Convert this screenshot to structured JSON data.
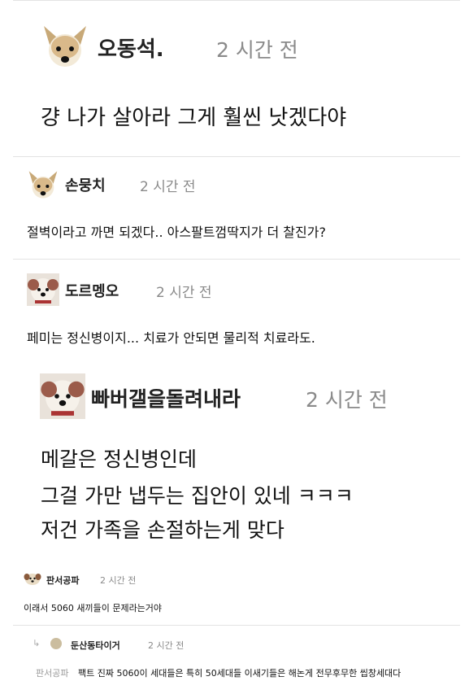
{
  "comments": [
    {
      "author": "오동석.",
      "time": "2 시간 전",
      "text": "걍 나가 살아라 그게 훨씬 낫겠다야",
      "avatar_icon": "dog-face-icon"
    },
    {
      "author": "손뭉치",
      "time": "2 시간 전",
      "text": "절벽이라고 까면 되겠다.. 아스팔트껌딱지가 더 찰진가?",
      "avatar_icon": "dog-face-icon"
    },
    {
      "author": "도르멩오",
      "time": "2 시간 전",
      "text": "페미는 정신병이지... 치료가 안되면 물리적 치료라도.",
      "avatar_icon": "fluffy-dog-icon"
    },
    {
      "author": "빠버갤을돌려내라",
      "time": "2 시간 전",
      "lines": [
        "메갈은 정신병인데",
        "그걸 가만 냅두는 집안이 있네 ㅋㅋㅋ",
        "저건 가족을 손절하는게 맞다"
      ],
      "avatar_icon": "fluffy-dog-icon"
    },
    {
      "author": "판서공파",
      "time": "2 시간 전",
      "text": "이래서 5060 새끼들이 문제라는거야",
      "avatar_icon": "small-dog-icon"
    },
    {
      "author": "둔산동타이거",
      "time": "2 시간 전",
      "mention": "판서공파",
      "text": "팩트 진짜 5060이 세대들은 특히 50세대들 이새기들은 해논게 전무후무한 씹창세대다",
      "avatar_icon": "circle-avatar-icon"
    }
  ],
  "colors": {
    "text": "#111111",
    "time": "#8a8a8a",
    "divider": "#e3e3e3",
    "mention": "#999999"
  }
}
